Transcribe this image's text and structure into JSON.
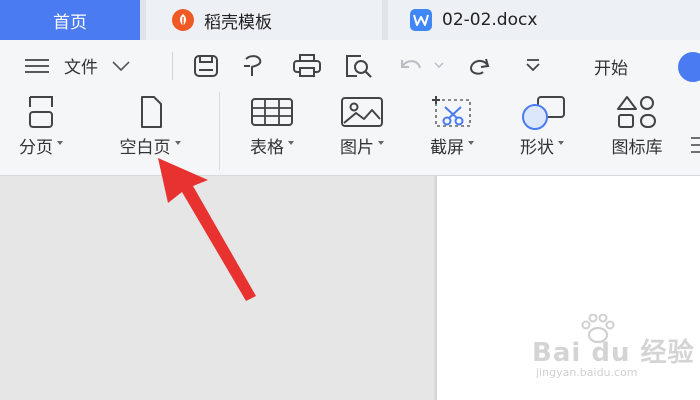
{
  "tabs": {
    "home": "首页",
    "template": "稻壳模板",
    "document": "02-02.docx"
  },
  "toolbar": {
    "file_menu": "文件",
    "start": "开始"
  },
  "ribbon": {
    "page_break": "分页",
    "blank_page": "空白页",
    "table": "表格",
    "picture": "图片",
    "screenshot": "截屏",
    "shape": "形状",
    "icon_library": "图标库"
  },
  "watermark": {
    "logo": "Bai du 经验",
    "sub": "jingyan.baidu.com"
  },
  "colors": {
    "accent": "#4b7bf1",
    "template_icon": "#ef5a24",
    "doc_icon": "#3f86f7",
    "annotation": "#e8322f"
  }
}
